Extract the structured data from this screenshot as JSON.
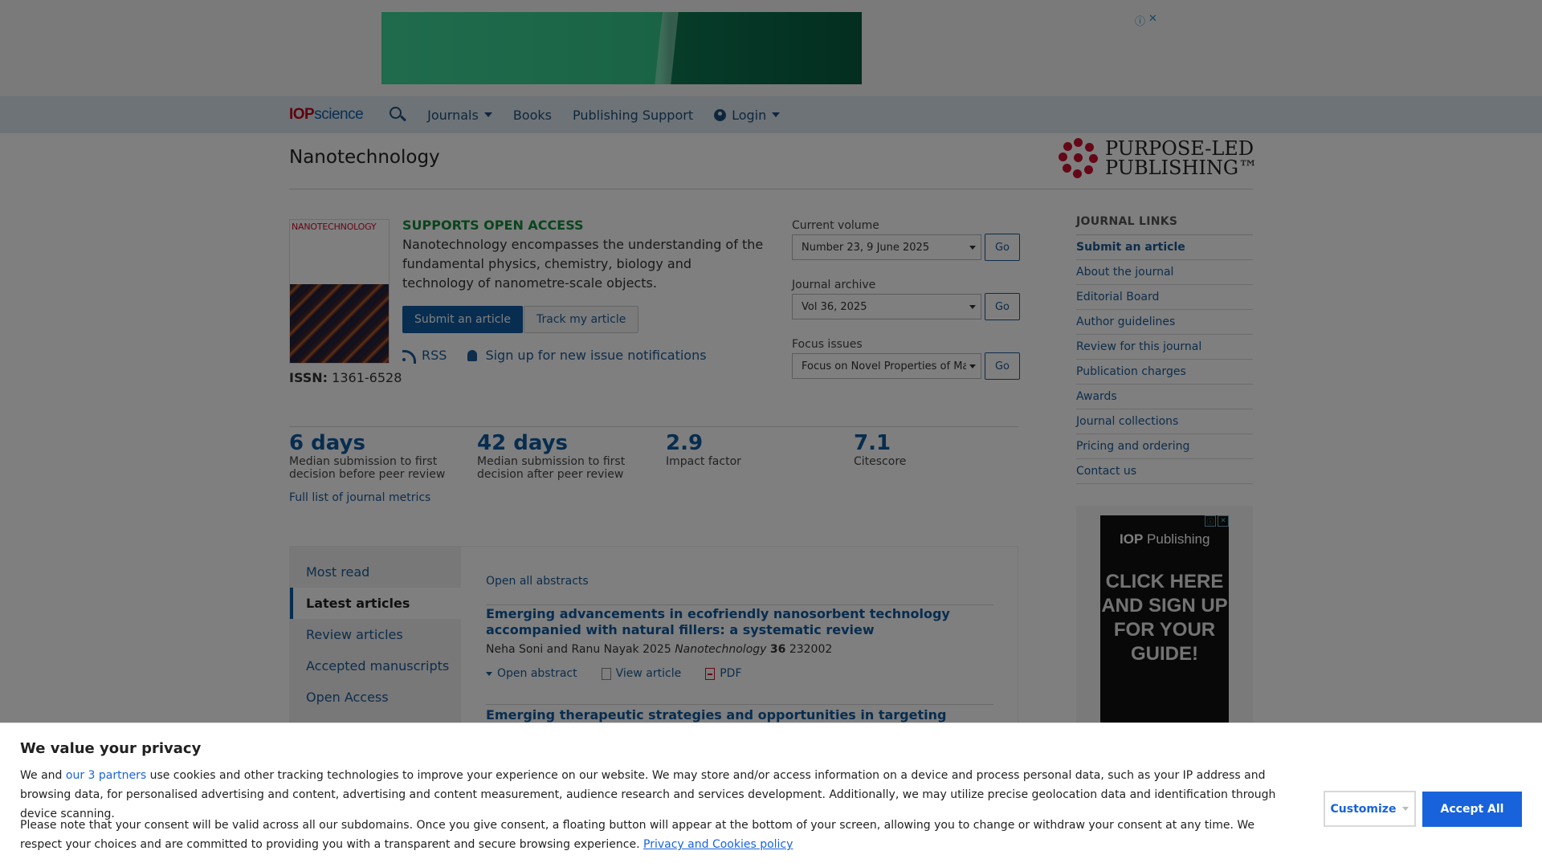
{
  "ad_top": {
    "controls": [
      "ⓘ",
      "✕"
    ]
  },
  "nav": {
    "logo_iop": "IOP",
    "logo_science": "science",
    "items": [
      {
        "label": "Journals",
        "has_caret": true
      },
      {
        "label": "Books"
      },
      {
        "label": "Publishing Support"
      },
      {
        "label": "Login",
        "has_caret": true
      }
    ]
  },
  "journal": {
    "title": "Nanotechnology",
    "publisher_logo_line1": "PURPOSE-LED",
    "publisher_logo_line2": "PUBLISHING™",
    "cover_title": "NANOTECHNOLOGY",
    "issn_label": "ISSN:",
    "issn_value": "1361-6528",
    "open_access_label": "SUPPORTS OPEN ACCESS",
    "description": "Nanotechnology encompasses the understanding of the fundamental physics, chemistry, biology and technology of nanometre-scale objects.",
    "submit_button": "Submit an article",
    "track_button": "Track my article",
    "rss_label": "RSS",
    "notify_label": "Sign up for new issue notifications"
  },
  "selectors": [
    {
      "label": "Current volume",
      "value": "Number 23, 9 June 2025",
      "go": "Go"
    },
    {
      "label": "Journal archive",
      "value": "Vol 36, 2025",
      "go": "Go"
    },
    {
      "label": "Focus issues",
      "value": "Focus on Novel Properties of Materials",
      "go": "Go"
    }
  ],
  "journal_links": {
    "heading": "JOURNAL LINKS",
    "items": [
      "Submit an article",
      "About the journal",
      "Editorial Board",
      "Author guidelines",
      "Review for this journal",
      "Publication charges",
      "Awards",
      "Journal collections",
      "Pricing and ordering",
      "Contact us"
    ]
  },
  "metrics": {
    "items": [
      {
        "value": "6 days",
        "desc": "Median submission to first decision before peer review"
      },
      {
        "value": "42 days",
        "desc": "Median submission to first decision after peer review"
      },
      {
        "value": "2.9",
        "desc": "Impact factor"
      },
      {
        "value": "7.1",
        "desc": "Citescore"
      }
    ],
    "full_list_link": "Full list of journal metrics"
  },
  "articles_panel": {
    "tabs": [
      "Most read",
      "Latest articles",
      "Review articles",
      "Accepted manuscripts",
      "Open Access"
    ],
    "active_tab": "Latest articles",
    "open_all": "Open all abstracts",
    "articles": [
      {
        "title": "Emerging advancements in ecofriendly nanosorbent technology accompanied with natural fillers: a systematic review",
        "authors": "Neha Soni and Ranu Nayak 2025",
        "journal": "Nanotechnology",
        "volume": "36",
        "article_no": "232002",
        "open_abstract": "Open abstract",
        "view_article": "View article",
        "pdf": "PDF"
      },
      {
        "title": "Emerging therapeutic strategies and opportunities in targeting protein pathways for"
      }
    ]
  },
  "side_ad": {
    "brand_bold": "IOP",
    "brand_rest": " Publishing",
    "cta": "CLICK HERE AND SIGN UP FOR YOUR GUIDE!",
    "controls": [
      "ⓘ",
      "✕"
    ]
  },
  "cookie": {
    "title": "We value your privacy",
    "p1_before": "We and ",
    "p1_link": "our 3 partners",
    "p1_after": " use cookies and other tracking technologies to improve your experience on our website. We may store and/or access information on a device and process personal data, such as your IP address and browsing data, for personalised advertising and content, advertising and content measurement, audience research and services development. Additionally, we may utilize precise geolocation data and identification through device scanning.",
    "p2_text": "Please note that your consent will be valid across all our subdomains. Once you give consent, a floating button will appear at the bottom of your screen, allowing you to change or withdraw your consent at any time. We respect your choices and are committed to providing you with a transparent and secure browsing experience. ",
    "p2_link": "Privacy and Cookies policy",
    "customize": "Customize",
    "accept": "Accept All"
  },
  "colors": {
    "brand_blue": "#0f5aa0",
    "open_access_green": "#148a3a",
    "cookie_accent": "#1863dc",
    "iop_red": "#c0001a"
  }
}
